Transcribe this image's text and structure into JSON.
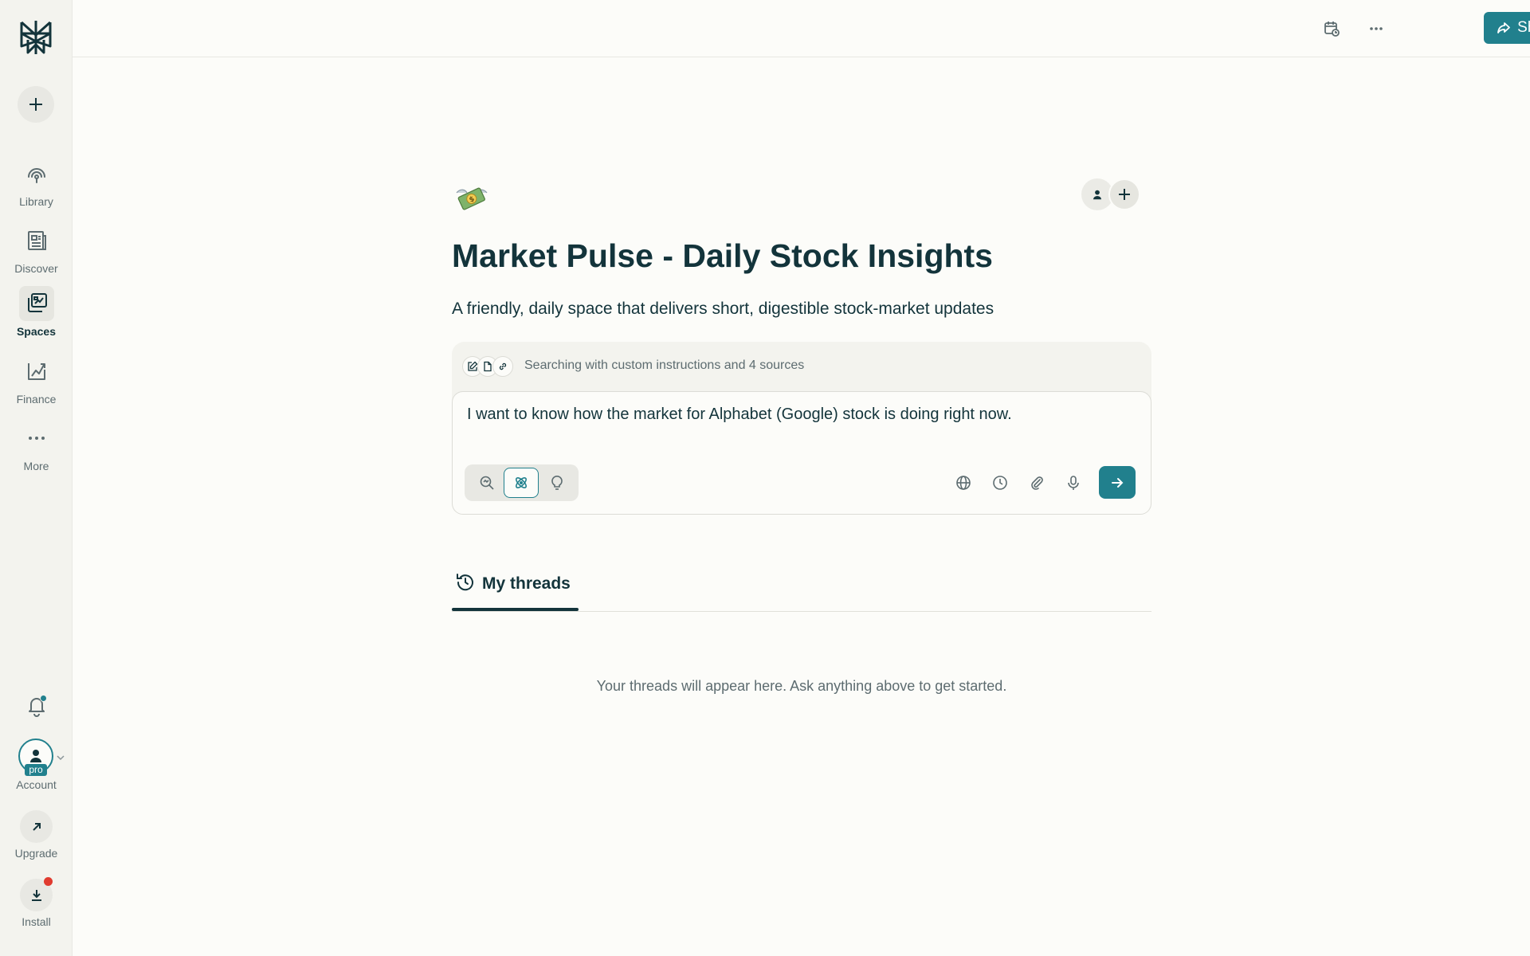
{
  "sidebar": {
    "items": [
      {
        "label": "Library",
        "icon": "library-icon"
      },
      {
        "label": "Discover",
        "icon": "discover-icon"
      },
      {
        "label": "Spaces",
        "icon": "spaces-icon"
      },
      {
        "label": "Finance",
        "icon": "finance-icon"
      },
      {
        "label": "More",
        "icon": "more-icon"
      }
    ],
    "active_item": "Spaces",
    "account_label": "Account",
    "pro_badge": "pro",
    "upgrade_label": "Upgrade",
    "install_label": "Install"
  },
  "topbar": {
    "share_label": "Share"
  },
  "space": {
    "title": "Market Pulse - Daily Stock Insights",
    "description": "A friendly, daily space that delivers short, digestible stock-market updates",
    "emoji": "money-with-wings"
  },
  "composer": {
    "context_text": "Searching with custom instructions and 4 sources",
    "query": "I want to know how the market for Alphabet (Google) stock is doing right now.",
    "modes": [
      "search",
      "research",
      "labs"
    ],
    "active_mode": "research"
  },
  "threads": {
    "tab_label": "My threads",
    "empty_message": "Your threads will appear here. Ask anything above to get started."
  },
  "colors": {
    "accent": "#21808d",
    "text": "#13343b",
    "background": "#fcfcf9",
    "sidebar_bg": "#f3f3ee",
    "notification_red": "#e03b2f"
  }
}
